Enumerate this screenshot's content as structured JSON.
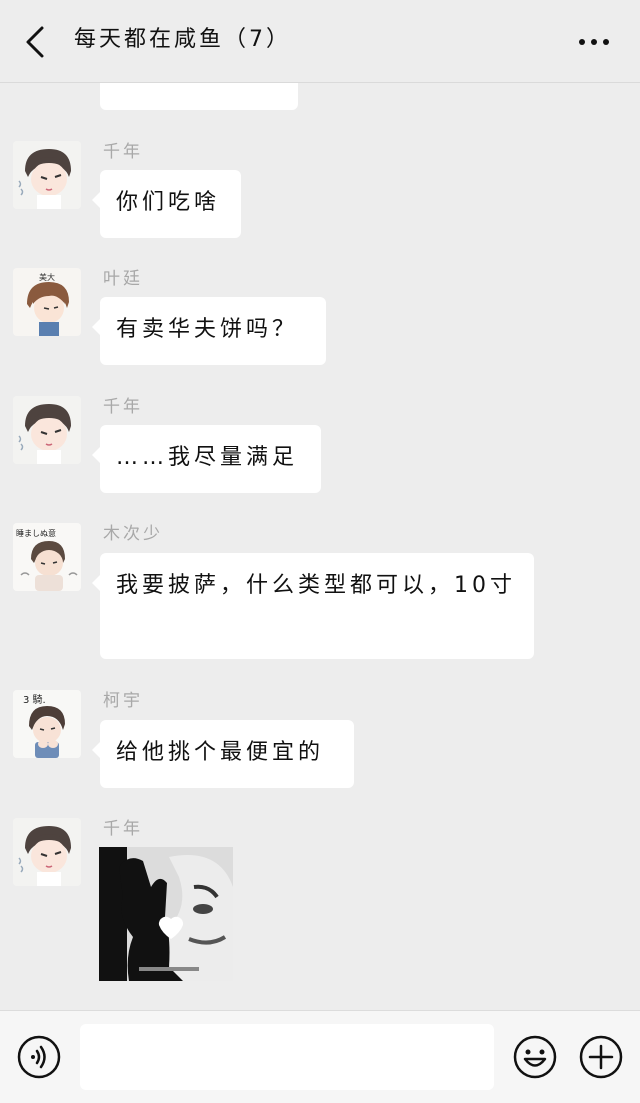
{
  "header": {
    "title": "每天都在咸鱼（7）",
    "back_icon": "chevron-left-icon",
    "more_icon": "more-dots-icon"
  },
  "messages": [
    {
      "sender": "",
      "text": "",
      "partial": true
    },
    {
      "sender": "千年",
      "text": "你们吃啥",
      "avatar": "boy-dark-hair-avatar"
    },
    {
      "sender": "叶廷",
      "text": "有卖华夫饼吗？",
      "avatar": "boy-light-hair-avatar",
      "avatar_caption": "美大"
    },
    {
      "sender": "千年",
      "text": "……我尽量满足",
      "avatar": "boy-dark-hair-avatar"
    },
    {
      "sender": "木次少",
      "text": "我要披萨，什么类型都可以，10寸",
      "avatar": "boy-sketch-avatar",
      "avatar_caption": "睡ましぬ意"
    },
    {
      "sender": "柯宇",
      "text": "给他挑个最便宜的",
      "avatar": "boy-hands-avatar",
      "avatar_caption": "3 騎."
    },
    {
      "sender": "千年",
      "type": "sticker",
      "sticker": "hand-heart-meme-sticker",
      "avatar": "boy-dark-hair-avatar"
    }
  ],
  "input_bar": {
    "voice_icon": "voice-icon",
    "input_placeholder": "",
    "emoji_icon": "emoji-icon",
    "plus_icon": "plus-icon"
  },
  "colors": {
    "background": "#ededed",
    "bubble": "#ffffff",
    "sender_name": "#a8a8a8"
  }
}
